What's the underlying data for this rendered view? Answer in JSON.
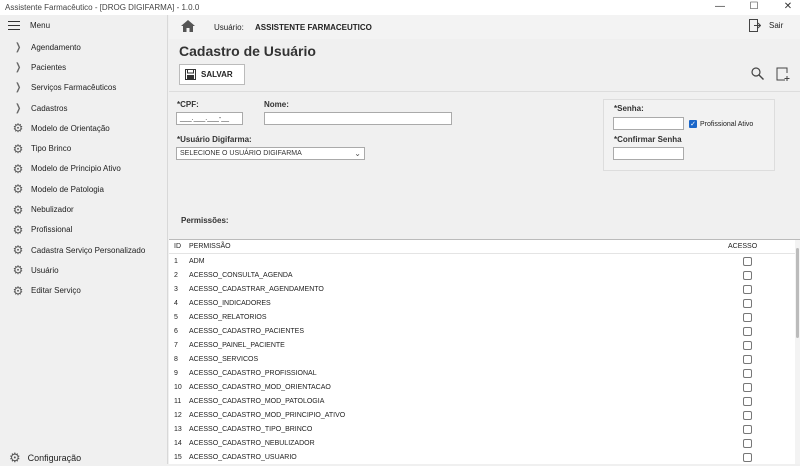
{
  "window": {
    "title": "Assistente Farmacêutico - [DROG DIGIFARMA] - 1.0.0",
    "minimize": "—",
    "maximize": "☐",
    "close": "✕"
  },
  "sidebar": {
    "menu_label": "Menu",
    "items": [
      {
        "label": "Agendamento",
        "icon": "chevron-right-icon"
      },
      {
        "label": "Pacientes",
        "icon": "chevron-right-icon"
      },
      {
        "label": "Serviços Farmacêuticos",
        "icon": "chevron-right-icon"
      },
      {
        "label": "Cadastros",
        "icon": "chevron-right-icon"
      },
      {
        "label": "Modelo de Orientação",
        "icon": "gears-icon"
      },
      {
        "label": "Tipo Brinco",
        "icon": "gears-icon"
      },
      {
        "label": "Modelo de Principio Ativo",
        "icon": "gears-icon"
      },
      {
        "label": "Modelo de Patologia",
        "icon": "gears-icon"
      },
      {
        "label": "Nebulizador",
        "icon": "gears-icon"
      },
      {
        "label": "Profissional",
        "icon": "gears-icon"
      },
      {
        "label": "Cadastra Serviço Personalizado",
        "icon": "gears-icon"
      },
      {
        "label": "Usuário",
        "icon": "gears-icon"
      },
      {
        "label": "Editar Serviço",
        "icon": "gears-icon"
      }
    ],
    "config_label": "Configuração"
  },
  "topbar": {
    "user_label": "Usuário:",
    "user_value": "ASSISTENTE FARMACEUTICO",
    "exit_label": "Sair"
  },
  "page": {
    "title": "Cadastro de Usuário",
    "save_label": "SALVAR"
  },
  "form": {
    "cpf_label": "*CPF:",
    "cpf_value": "___.___.___-__",
    "name_label": "Nome:",
    "name_value": "",
    "usuario_label": "*Usuário Digifarma:",
    "usuario_value": "SELECIONE O USUÁRIO DIGIFARMA",
    "senha_label": "*Senha:",
    "senha_value": "",
    "confirmar_label": "*Confirmar Senha",
    "confirmar_value": "",
    "profissional_label": "Profissional Ativo",
    "profissional_checked": true
  },
  "permissions": {
    "label": "Permissões:",
    "headers": {
      "id": "ID",
      "perm": "PERMISSÃO",
      "acesso": "ACESSO"
    },
    "rows": [
      {
        "id": "1",
        "perm": "ADM",
        "checked": false
      },
      {
        "id": "2",
        "perm": "ACESSO_CONSULTA_AGENDA",
        "checked": false
      },
      {
        "id": "3",
        "perm": "ACESSO_CADASTRAR_AGENDAMENTO",
        "checked": false
      },
      {
        "id": "4",
        "perm": "ACESSO_INDICADORES",
        "checked": false
      },
      {
        "id": "5",
        "perm": "ACESSO_RELATORIOS",
        "checked": false
      },
      {
        "id": "6",
        "perm": "ACESSO_CADASTRO_PACIENTES",
        "checked": false
      },
      {
        "id": "7",
        "perm": "ACESSO_PAINEL_PACIENTE",
        "checked": false
      },
      {
        "id": "8",
        "perm": "ACESSO_SERVICOS",
        "checked": false
      },
      {
        "id": "9",
        "perm": "ACESSO_CADASTRO_PROFISSIONAL",
        "checked": false
      },
      {
        "id": "10",
        "perm": "ACESSO_CADASTRO_MOD_ORIENTACAO",
        "checked": false
      },
      {
        "id": "11",
        "perm": "ACESSO_CADASTRO_MOD_PATOLOGIA",
        "checked": false
      },
      {
        "id": "12",
        "perm": "ACESSO_CADASTRO_MOD_PRINCIPIO_ATIVO",
        "checked": false
      },
      {
        "id": "13",
        "perm": "ACESSO_CADASTRO_TIPO_BRINCO",
        "checked": false
      },
      {
        "id": "14",
        "perm": "ACESSO_CADASTRO_NEBULIZADOR",
        "checked": false
      },
      {
        "id": "15",
        "perm": "ACESSO_CADASTRO_USUARIO",
        "checked": false
      }
    ]
  },
  "colors": {
    "accent": "#1a66c9",
    "background": "#f0f0f0"
  }
}
